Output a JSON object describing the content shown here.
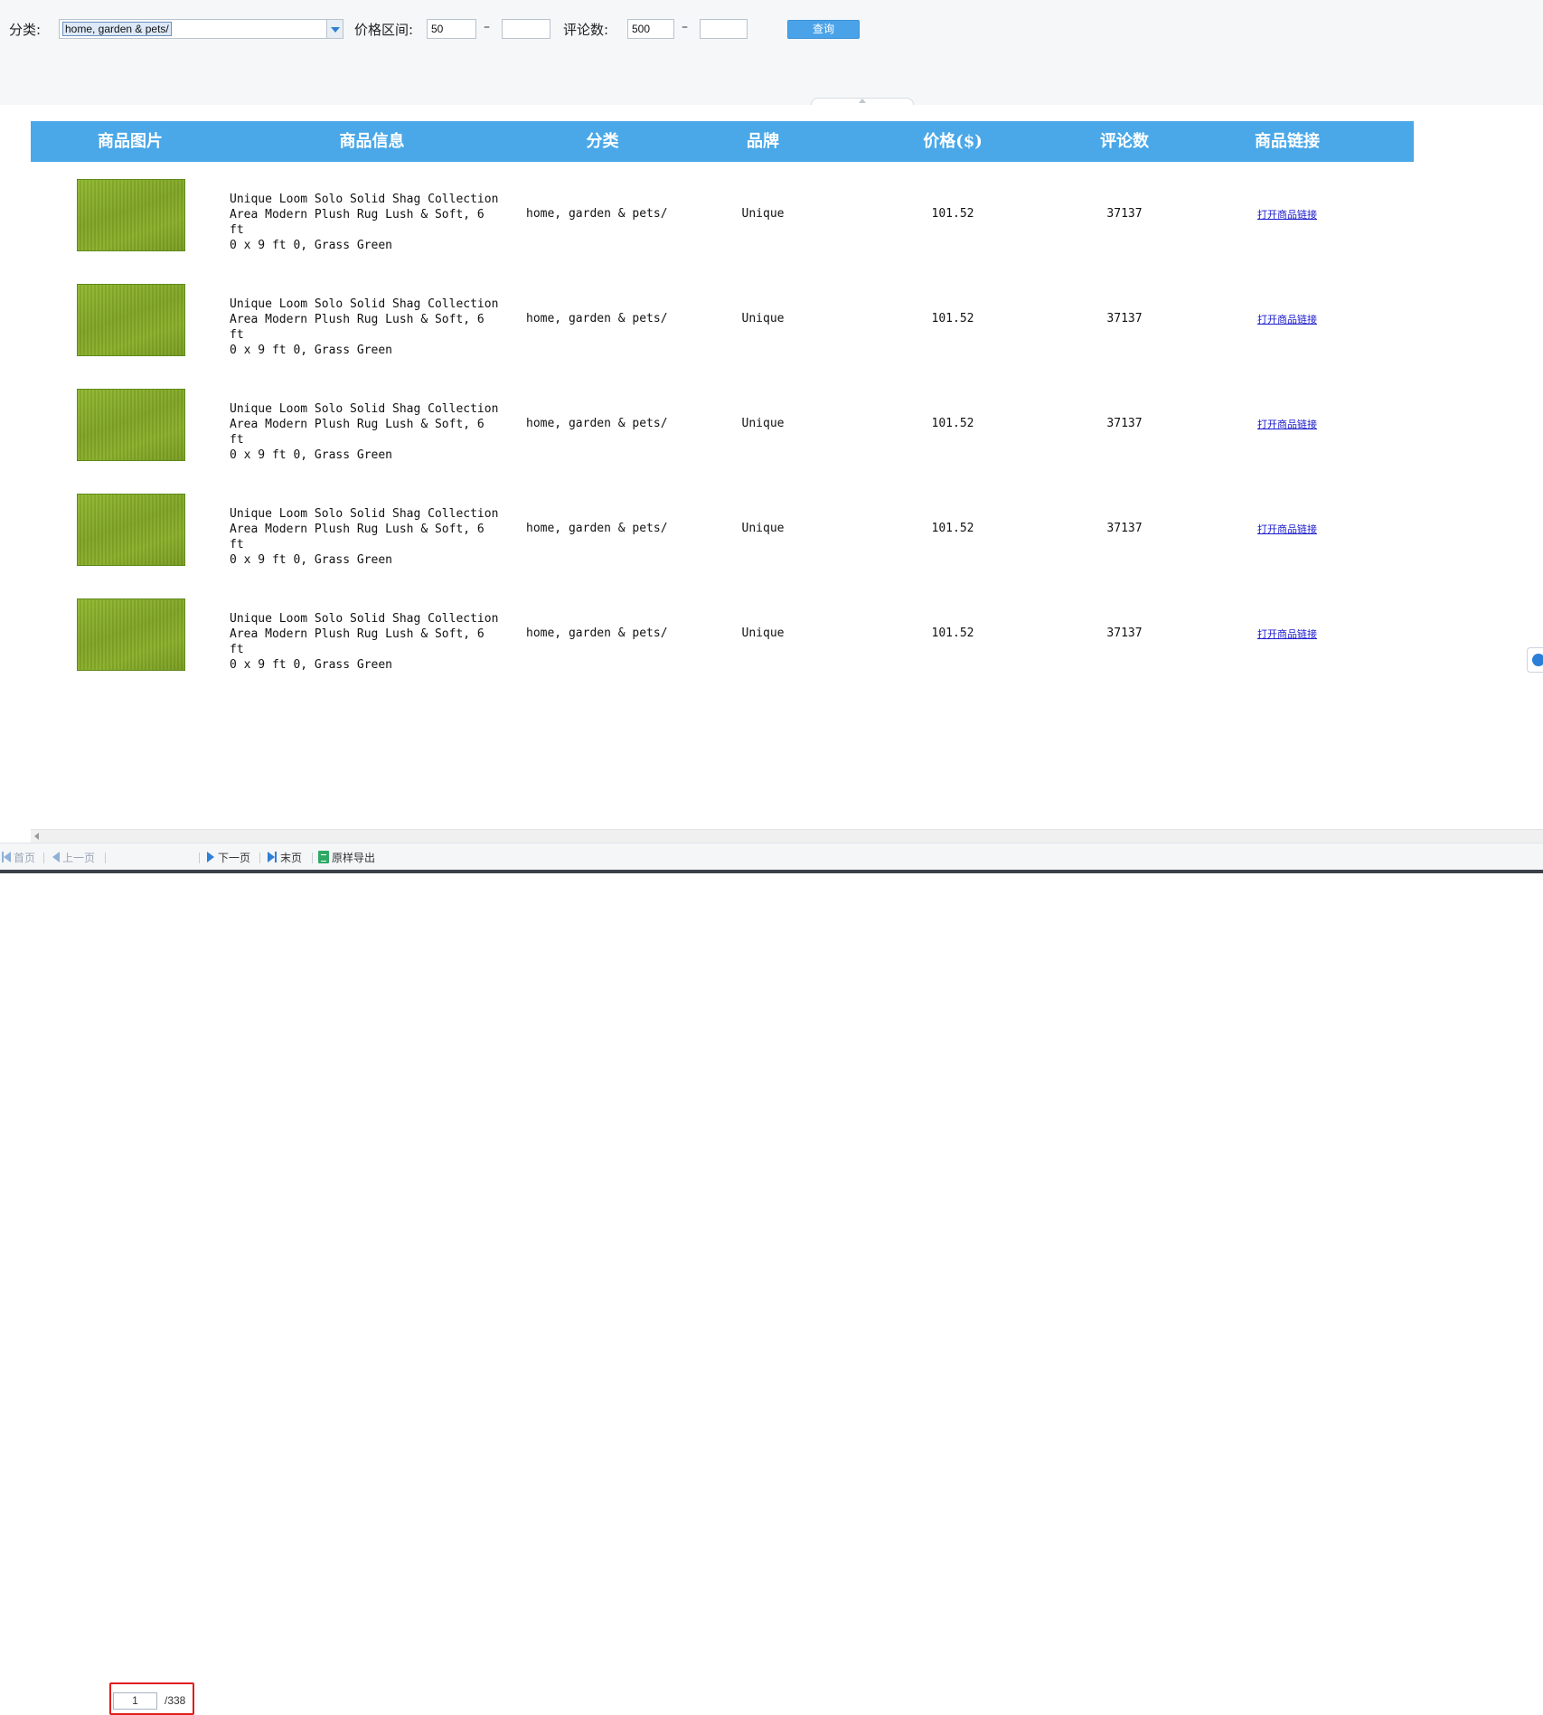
{
  "filters": {
    "category_label": "分类:",
    "category_value": "home, garden & pets/",
    "price_label": "价格区间:",
    "price_min": "50",
    "price_max": "",
    "price_dash": "–",
    "reviews_label": "评论数:",
    "reviews_min": "500",
    "reviews_max": "",
    "reviews_dash": "–",
    "query_button": "查询"
  },
  "table": {
    "headers": [
      "商品图片",
      "商品信息",
      "分类",
      "品牌",
      "价格($)",
      "评论数",
      "商品链接"
    ],
    "rows": [
      {
        "info": "Unique Loom Solo Solid Shag Collection\nArea Modern Plush Rug Lush & Soft, 6 ft\n0 x 9 ft 0, Grass Green",
        "category": "home, garden & pets/",
        "brand": "Unique",
        "price": "101.52",
        "reviews": "37137",
        "link": "打开商品链接"
      },
      {
        "info": "Unique Loom Solo Solid Shag Collection\nArea Modern Plush Rug Lush & Soft, 6 ft\n0 x 9 ft 0, Grass Green",
        "category": "home, garden & pets/",
        "brand": "Unique",
        "price": "101.52",
        "reviews": "37137",
        "link": "打开商品链接"
      },
      {
        "info": "Unique Loom Solo Solid Shag Collection\nArea Modern Plush Rug Lush & Soft, 6 ft\n0 x 9 ft 0, Grass Green",
        "category": "home, garden & pets/",
        "brand": "Unique",
        "price": "101.52",
        "reviews": "37137",
        "link": "打开商品链接"
      },
      {
        "info": "Unique Loom Solo Solid Shag Collection\nArea Modern Plush Rug Lush & Soft, 6 ft\n0 x 9 ft 0, Grass Green",
        "category": "home, garden & pets/",
        "brand": "Unique",
        "price": "101.52",
        "reviews": "37137",
        "link": "打开商品链接"
      },
      {
        "info": "Unique Loom Solo Solid Shag Collection\nArea Modern Plush Rug Lush & Soft, 6 ft\n0 x 9 ft 0, Grass Green",
        "category": "home, garden & pets/",
        "brand": "Unique",
        "price": "101.52",
        "reviews": "37137",
        "link": "打开商品链接"
      }
    ]
  },
  "pager": {
    "first": "首页",
    "prev": "上一页",
    "current_page": "1",
    "total": "/338",
    "next": "下一页",
    "last": "末页",
    "export": "原样导出"
  },
  "colors": {
    "header_bg": "#4aa8e8",
    "query_button_bg": "#4aa3e8",
    "link_color": "#1a1acc",
    "highlight_border": "#e01d1d"
  }
}
